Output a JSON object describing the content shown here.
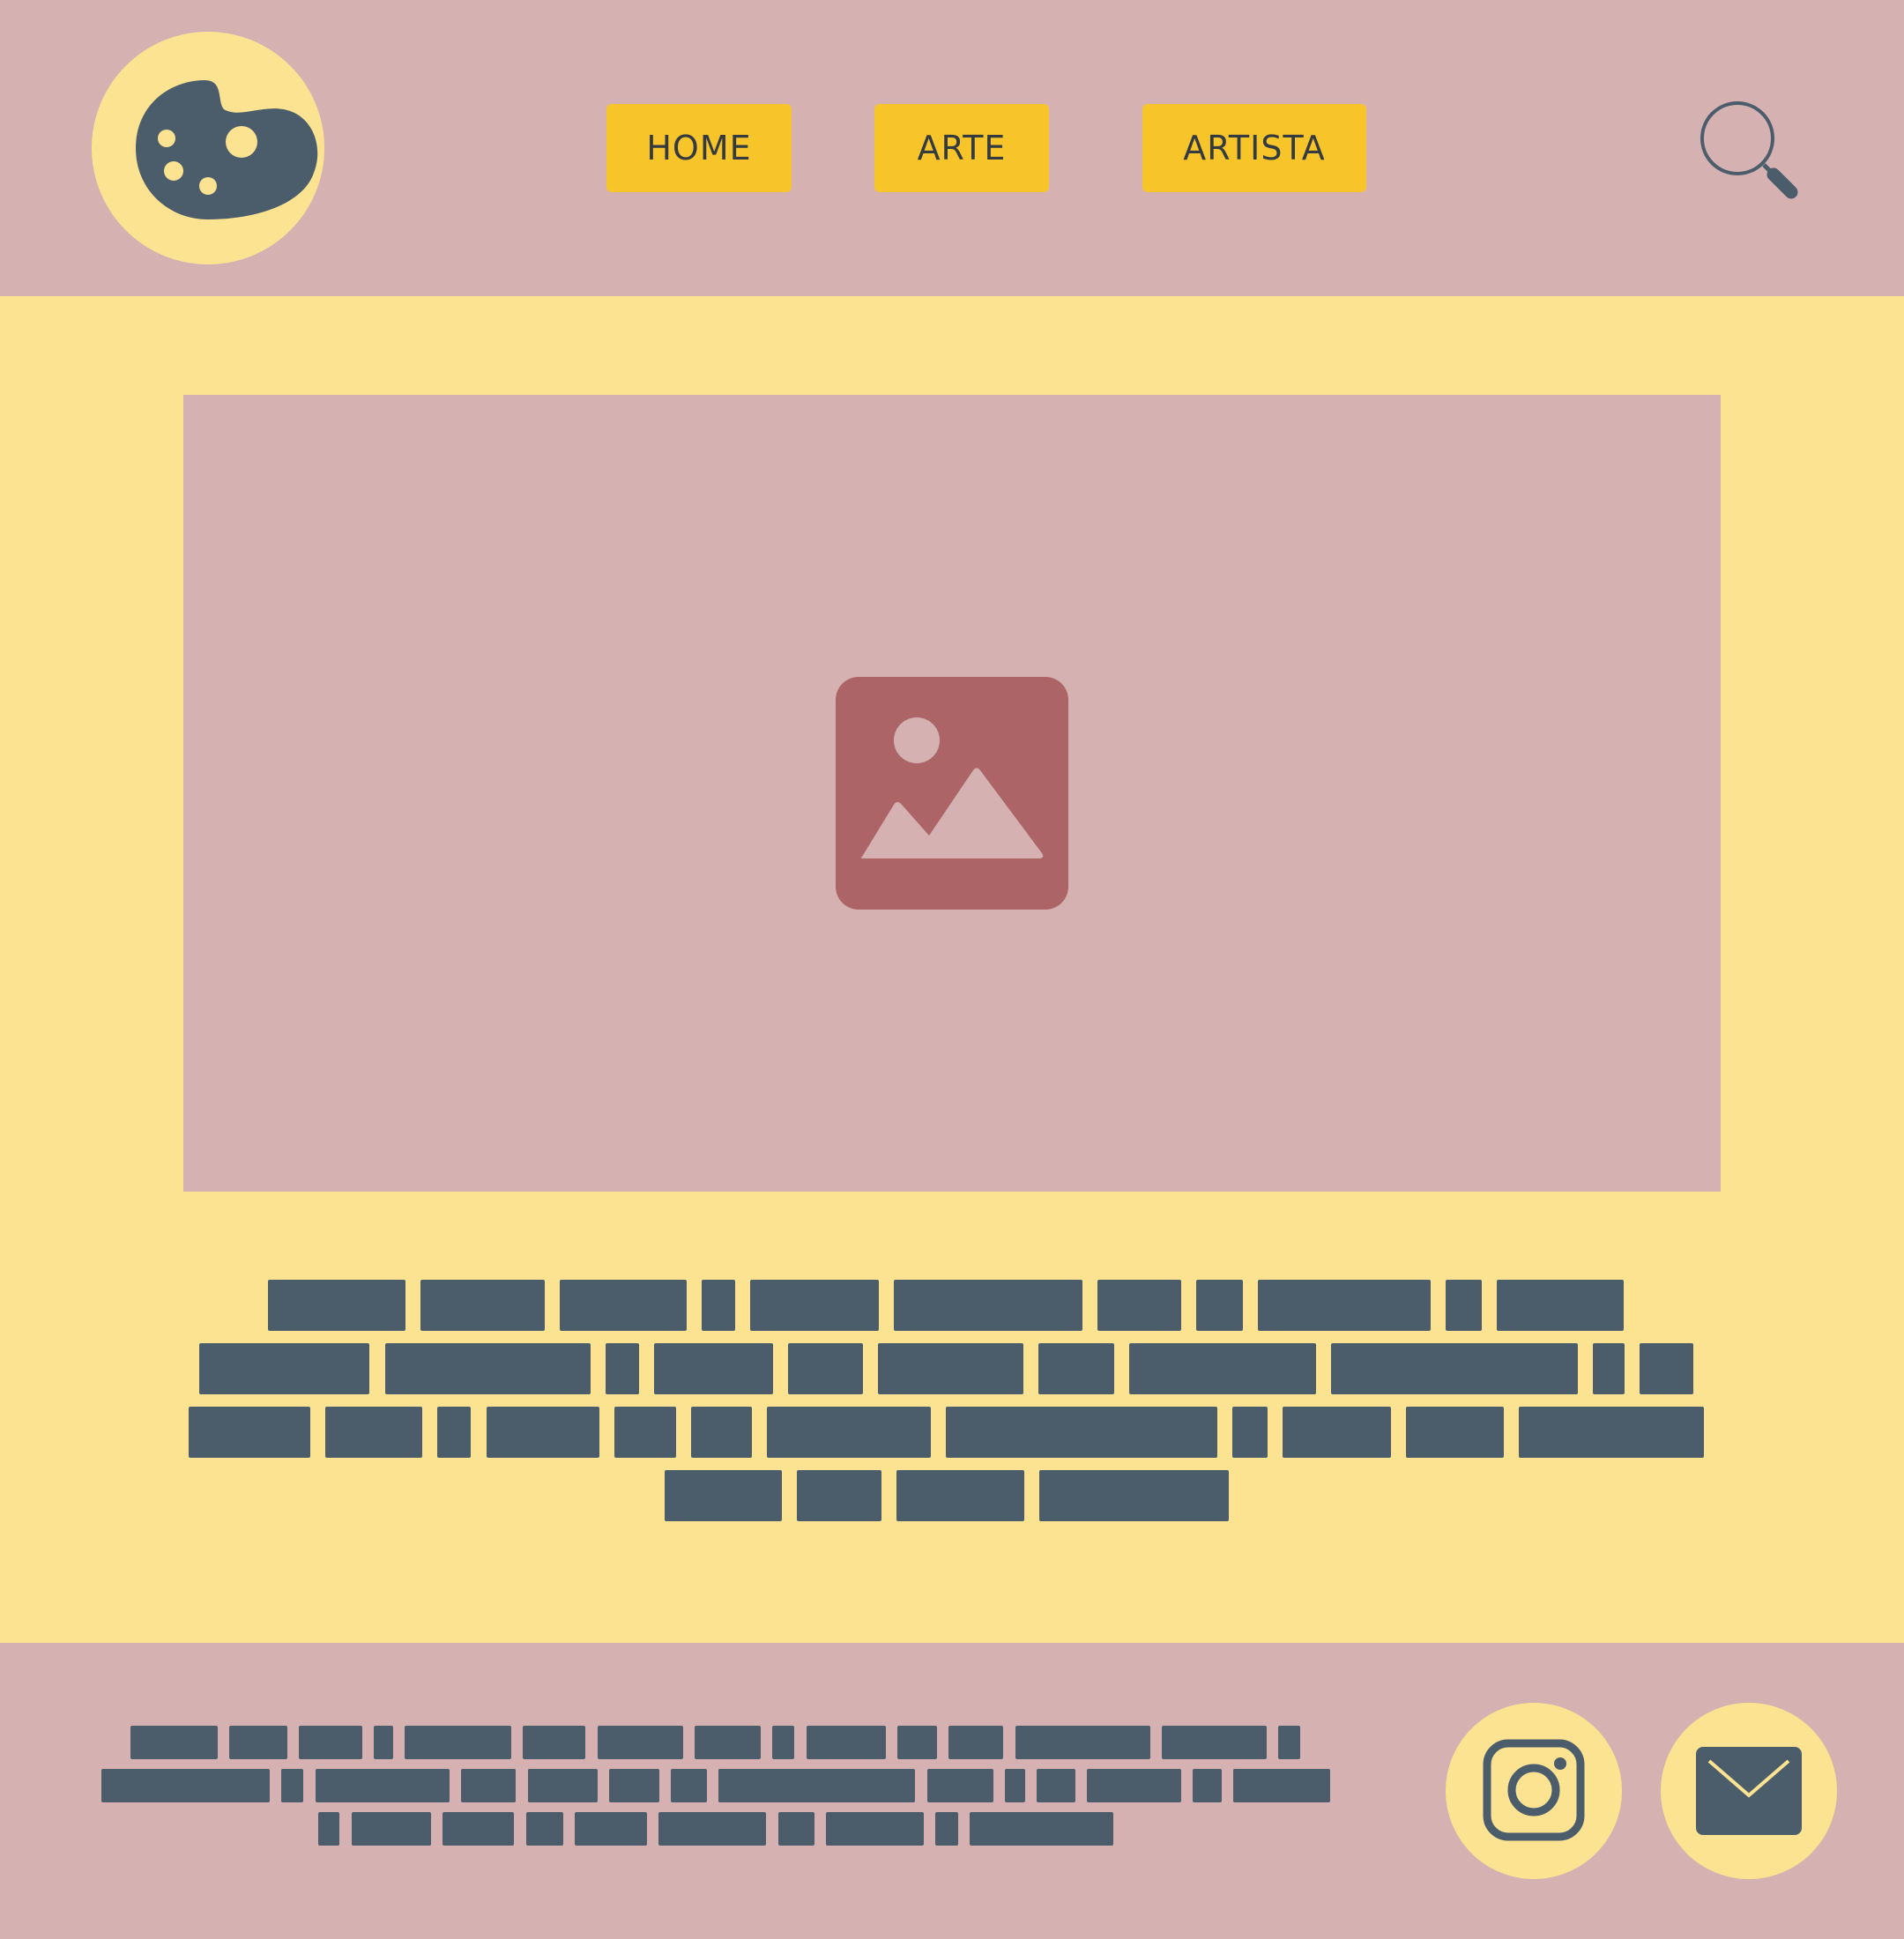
{
  "colors": {
    "header_bg": "#d5b1b2",
    "page_bg": "#fbe391",
    "nav_button": "#f7c429",
    "text_dark": "#4b5c6b",
    "image_icon": "#ad6466"
  },
  "header": {
    "logo_icon": "palette-icon",
    "nav": [
      {
        "label": "HOME"
      },
      {
        "label": "ARTE"
      },
      {
        "label": "ARTISTA"
      }
    ],
    "search_icon": "search-icon"
  },
  "main": {
    "hero_image_icon": "image-placeholder-icon",
    "text_placeholder_lines": 4
  },
  "footer": {
    "text_placeholder_lines": 3,
    "social": [
      {
        "icon": "instagram-icon"
      },
      {
        "icon": "mail-icon"
      }
    ]
  }
}
